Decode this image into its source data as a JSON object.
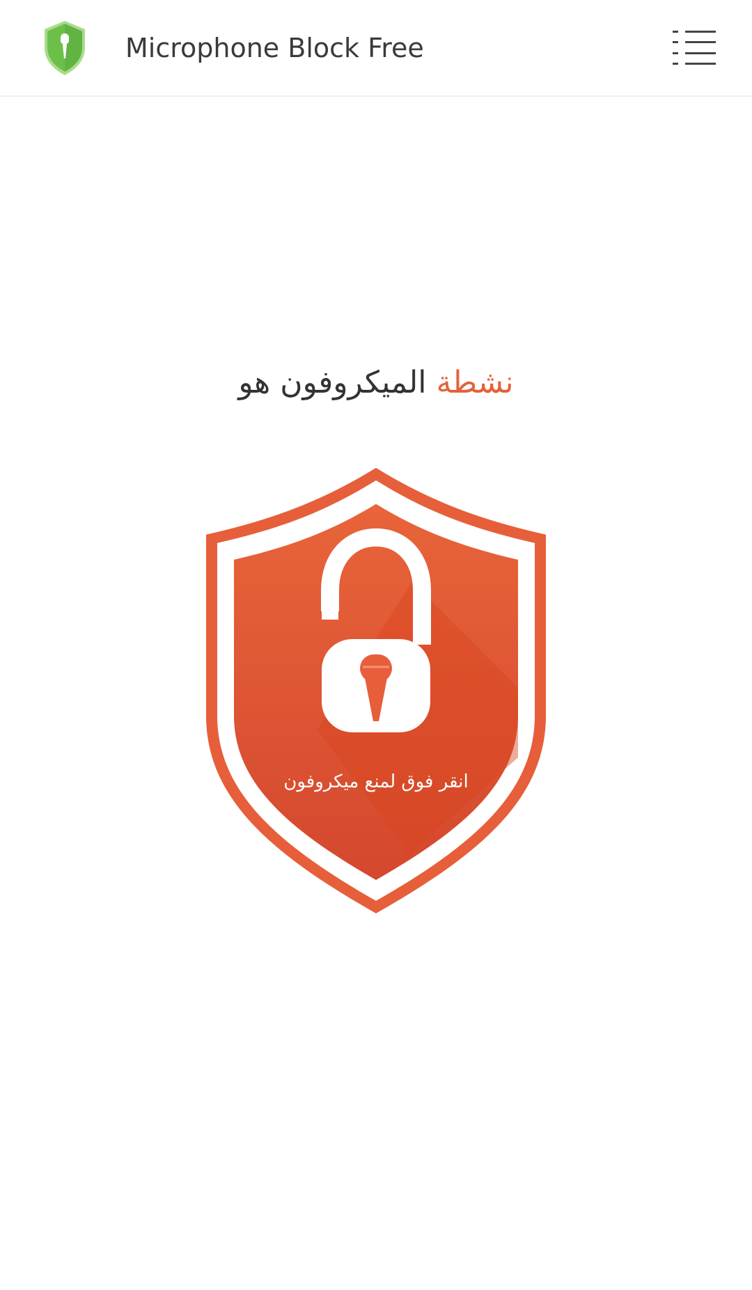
{
  "app_bar": {
    "title": "Microphone Block Free",
    "logo_icon": "microphone-shield-logo-icon",
    "menu_icon": "menu-list-icon"
  },
  "status": {
    "accent_word": "نشطة",
    "rest": "الميكروفون هو"
  },
  "shield": {
    "caption": "انقر فوق لمنع ميكروفون",
    "icon": "unlocked-padlock-microphone-icon"
  },
  "colors": {
    "accent": "#e4623a",
    "shield_outer": "#e65f3a",
    "logo_green": "#6cc04a",
    "title_text": "#3a3a3a"
  }
}
